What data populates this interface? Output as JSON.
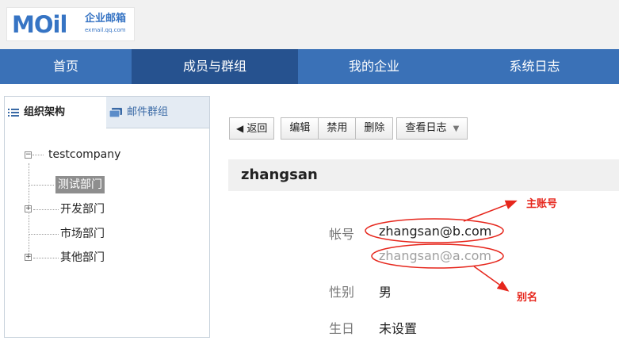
{
  "logo": {
    "mail": "MOil",
    "cn": "企业邮箱",
    "url": "exmail.qq.com"
  },
  "nav": [
    "首页",
    "成员与群组",
    "我的企业",
    "系统日志"
  ],
  "left_tabs": {
    "org": "组织架构",
    "mail_group": "邮件群组"
  },
  "tree": {
    "root": "testcompany",
    "nodes": [
      "测试部门",
      "开发部门",
      "市场部门",
      "其他部门"
    ]
  },
  "toolbar": {
    "back": "返回",
    "edit": "编辑",
    "disable": "禁用",
    "delete": "删除",
    "view_log": "查看日志"
  },
  "user": {
    "name": "zhangsan",
    "account_label": "帐号",
    "account_primary": "zhangsan@b.com",
    "account_alias": "zhangsan@a.com",
    "gender_label": "性别",
    "gender_value": "男",
    "birthday_label": "生日",
    "birthday_value": "未设置"
  },
  "annotations": {
    "primary": "主账号",
    "alias": "别名"
  },
  "colors": {
    "nav": "#3a71b7",
    "nav_active": "#26528f",
    "annotation": "#e6261c"
  }
}
